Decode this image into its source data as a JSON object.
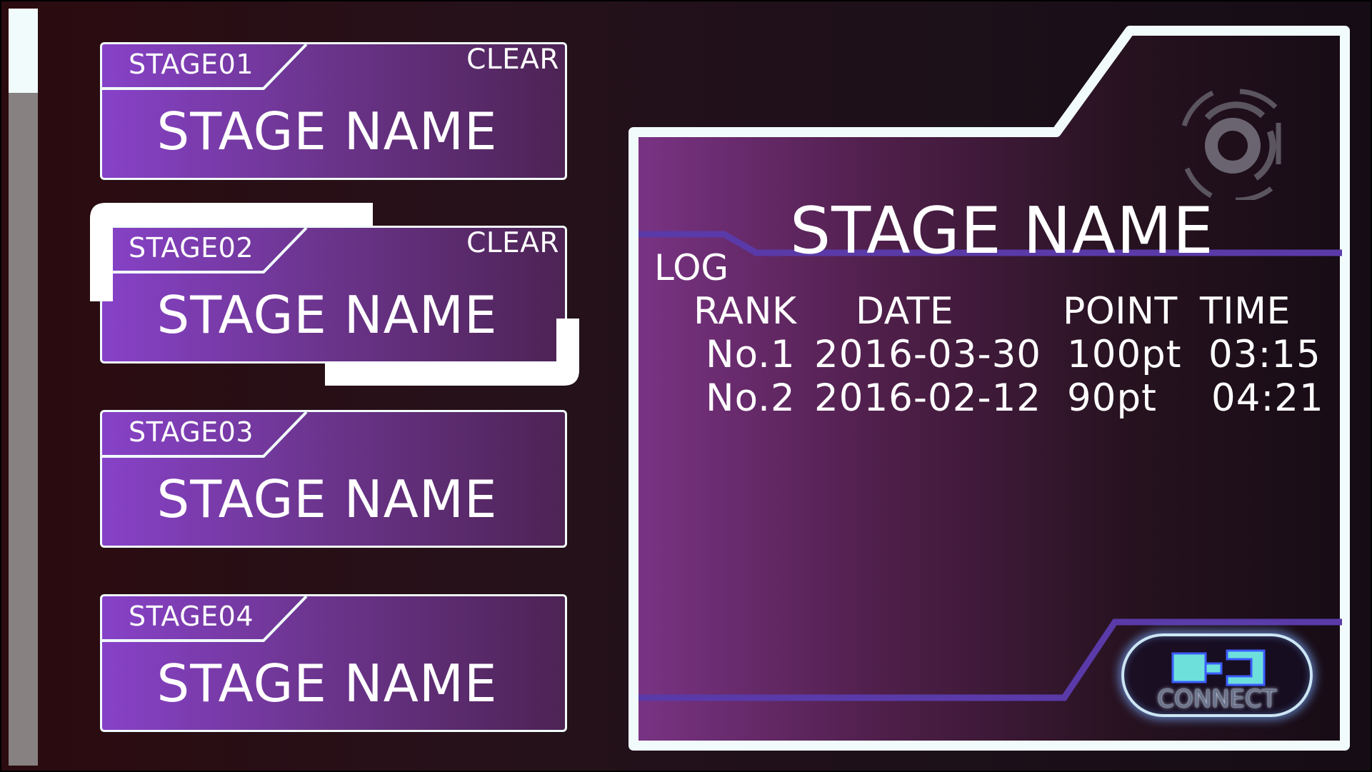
{
  "stages": [
    {
      "id": "STAGE01",
      "name": "STAGE NAME",
      "status": "CLEAR"
    },
    {
      "id": "STAGE02",
      "name": "STAGE NAME",
      "status": "CLEAR"
    },
    {
      "id": "STAGE03",
      "name": "STAGE NAME",
      "status": ""
    },
    {
      "id": "STAGE04",
      "name": "STAGE NAME",
      "status": ""
    }
  ],
  "selected_stage_index": 1,
  "detail": {
    "title": "STAGE NAME",
    "log_label": "LOG",
    "columns": [
      "RANK",
      "DATE",
      "POINT",
      "TIME"
    ],
    "rows": [
      {
        "rank": "No.1",
        "date": "2016-03-30",
        "point": "100pt",
        "time": "03:15"
      },
      {
        "rank": "No.2",
        "date": "2016-02-12",
        "point": "90pt",
        "time": "04:21"
      }
    ]
  },
  "connect_button": {
    "label": "CONNECT",
    "icon": "connector-plug-icon"
  },
  "colors": {
    "card_gradient_start": "#8742c8",
    "card_gradient_end": "#4d2354",
    "frame_border": "#f1fbfb",
    "accent_line": "#5a3aa8",
    "connect_icon": "#6ee0dc"
  },
  "icons": {
    "panel_emblem": "target-reticle-icon"
  }
}
